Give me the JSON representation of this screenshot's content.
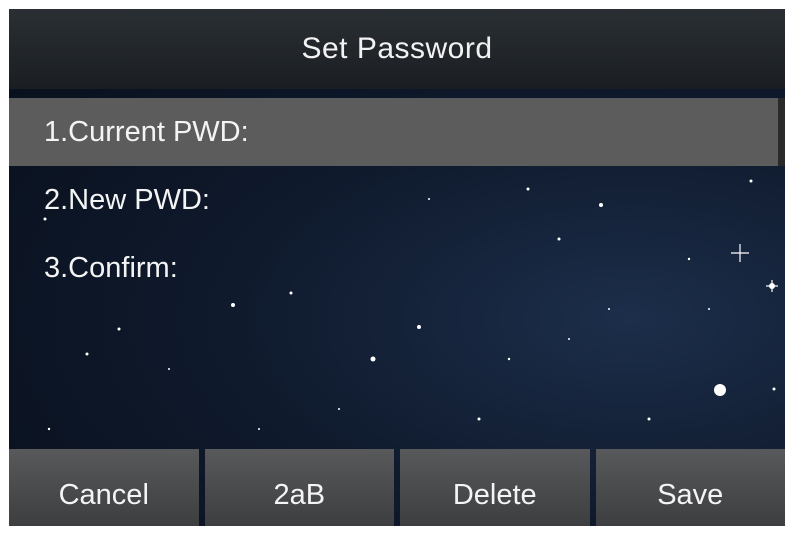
{
  "header": {
    "title": "Set Password"
  },
  "menu": {
    "items": [
      {
        "label": "1.Current PWD:",
        "selected": true
      },
      {
        "label": "2.New PWD:",
        "selected": false
      },
      {
        "label": "3.Confirm:",
        "selected": false
      }
    ]
  },
  "softkeys": {
    "cancel": "Cancel",
    "input_mode": "2aB",
    "delete": "Delete",
    "save": "Save"
  },
  "colors": {
    "title_bar": "#1f2428",
    "selected_row": "#5c5c5c",
    "softkey": "#4a4b4d",
    "background": "#0f1a2d",
    "text": "#f4f4f4"
  }
}
